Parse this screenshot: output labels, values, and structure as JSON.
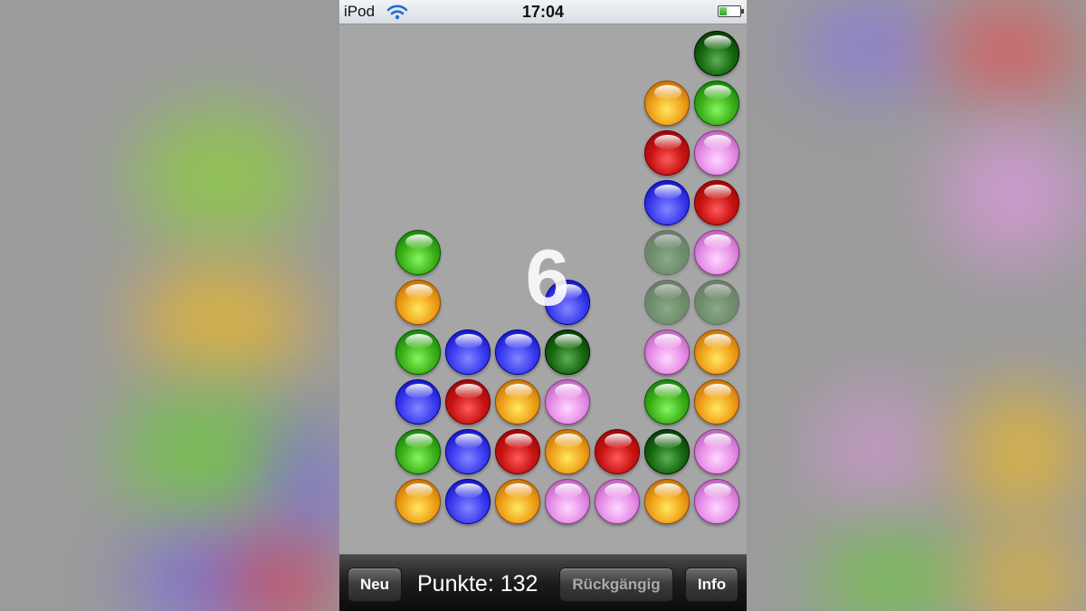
{
  "status_bar": {
    "carrier": "iPod",
    "time": "17:04",
    "battery_level": 0.35
  },
  "colors": {
    "green": "#3fb21a",
    "dark_green": "#186a10",
    "orange": "#f0a21a",
    "red": "#c91414",
    "blue": "#3d3ff0",
    "pink": "#e891e8",
    "background": "#a6a6a6"
  },
  "board": {
    "columns": 7,
    "rows": 10,
    "combo_number": "6",
    "cells": [
      {
        "col": 6,
        "row": 0,
        "color": "dark_green"
      },
      {
        "col": 5,
        "row": 1,
        "color": "orange"
      },
      {
        "col": 6,
        "row": 1,
        "color": "green"
      },
      {
        "col": 5,
        "row": 2,
        "color": "red"
      },
      {
        "col": 6,
        "row": 2,
        "color": "pink"
      },
      {
        "col": 5,
        "row": 3,
        "color": "blue"
      },
      {
        "col": 6,
        "row": 3,
        "color": "red"
      },
      {
        "col": 0,
        "row": 4,
        "color": "green"
      },
      {
        "col": 5,
        "row": 4,
        "color": "dark_green",
        "faded": true
      },
      {
        "col": 6,
        "row": 4,
        "color": "pink"
      },
      {
        "col": 0,
        "row": 5,
        "color": "orange"
      },
      {
        "col": 3,
        "row": 5,
        "color": "blue"
      },
      {
        "col": 5,
        "row": 5,
        "color": "dark_green",
        "faded": true
      },
      {
        "col": 6,
        "row": 5,
        "color": "dark_green",
        "faded": true
      },
      {
        "col": 0,
        "row": 6,
        "color": "green"
      },
      {
        "col": 1,
        "row": 6,
        "color": "blue"
      },
      {
        "col": 2,
        "row": 6,
        "color": "blue"
      },
      {
        "col": 3,
        "row": 6,
        "color": "dark_green"
      },
      {
        "col": 5,
        "row": 6,
        "color": "pink"
      },
      {
        "col": 6,
        "row": 6,
        "color": "orange"
      },
      {
        "col": 0,
        "row": 7,
        "color": "blue"
      },
      {
        "col": 1,
        "row": 7,
        "color": "red"
      },
      {
        "col": 2,
        "row": 7,
        "color": "orange"
      },
      {
        "col": 3,
        "row": 7,
        "color": "pink"
      },
      {
        "col": 5,
        "row": 7,
        "color": "green"
      },
      {
        "col": 6,
        "row": 7,
        "color": "orange"
      },
      {
        "col": 0,
        "row": 8,
        "color": "green"
      },
      {
        "col": 1,
        "row": 8,
        "color": "blue"
      },
      {
        "col": 2,
        "row": 8,
        "color": "red"
      },
      {
        "col": 3,
        "row": 8,
        "color": "orange"
      },
      {
        "col": 4,
        "row": 8,
        "color": "red"
      },
      {
        "col": 5,
        "row": 8,
        "color": "dark_green"
      },
      {
        "col": 6,
        "row": 8,
        "color": "pink"
      },
      {
        "col": 0,
        "row": 9,
        "color": "orange"
      },
      {
        "col": 1,
        "row": 9,
        "color": "blue"
      },
      {
        "col": 2,
        "row": 9,
        "color": "orange"
      },
      {
        "col": 3,
        "row": 9,
        "color": "pink"
      },
      {
        "col": 4,
        "row": 9,
        "color": "pink"
      },
      {
        "col": 5,
        "row": 9,
        "color": "orange"
      },
      {
        "col": 6,
        "row": 9,
        "color": "pink"
      }
    ]
  },
  "toolbar": {
    "new_label": "Neu",
    "score_label": "Punkte: 132",
    "undo_label": "Rückgängig",
    "info_label": "Info"
  }
}
